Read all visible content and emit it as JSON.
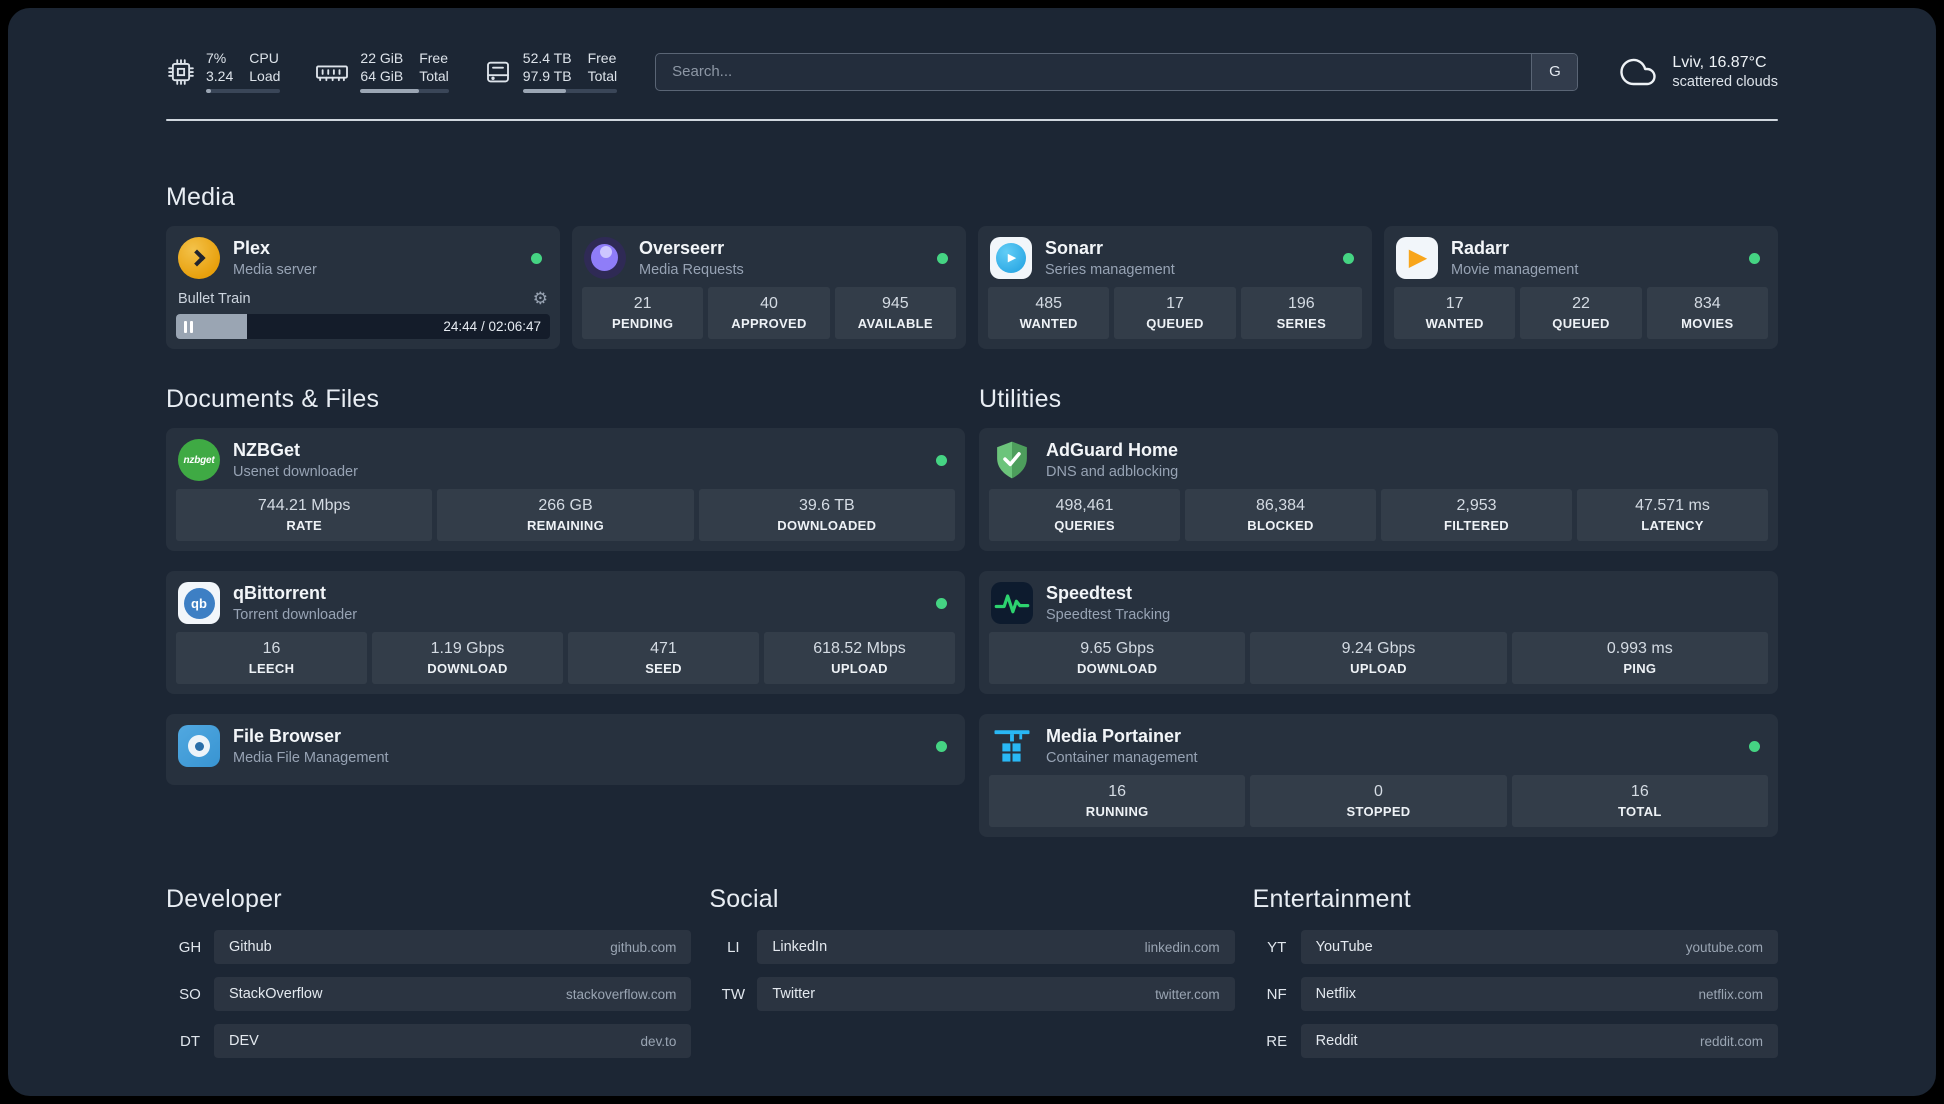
{
  "colors": {
    "status": "#45d483",
    "plex": "#e8a00c",
    "overseerr": "#8f7df8",
    "sonarr": "#1e9fe0",
    "radarr": "#f8a51b",
    "nzbget": "#3faa44",
    "qbittorrent": "#3d7fc4",
    "filebrowser": "#3894d2",
    "adguard": "#5cb46d",
    "speedtest": "#2dd36f",
    "portainer": "#29b8f5"
  },
  "topbar": {
    "cpu": {
      "usage": "7%",
      "load": "3.24",
      "label_top": "CPU",
      "label_bottom": "Load",
      "progress": 7
    },
    "memory": {
      "free": "22 GiB",
      "total": "64 GiB",
      "label_top": "Free",
      "label_bottom": "Total",
      "progress": 66
    },
    "disk": {
      "free": "52.4 TB",
      "total": "97.9 TB",
      "label_top": "Free",
      "label_bottom": "Total",
      "progress": 46
    },
    "search": {
      "placeholder": "Search...",
      "button_label": "G"
    },
    "weather": {
      "location": "Lviv, 16.87°C",
      "condition": "scattered clouds"
    }
  },
  "groups": [
    {
      "title": "Media",
      "cards": [
        {
          "id": "plex",
          "title": "Plex",
          "subtitle": "Media server",
          "online": true,
          "player": {
            "track": "Bullet Train",
            "time": "24:44 / 02:06:47",
            "progress": 19
          }
        },
        {
          "id": "overseerr",
          "title": "Overseerr",
          "subtitle": "Media Requests",
          "online": true,
          "stats": [
            {
              "value": "21",
              "label": "PENDING"
            },
            {
              "value": "40",
              "label": "APPROVED"
            },
            {
              "value": "945",
              "label": "AVAILABLE"
            }
          ]
        },
        {
          "id": "sonarr",
          "title": "Sonarr",
          "subtitle": "Series management",
          "online": true,
          "icon_text": "▶",
          "stats": [
            {
              "value": "485",
              "label": "WANTED"
            },
            {
              "value": "17",
              "label": "QUEUED"
            },
            {
              "value": "196",
              "label": "SERIES"
            }
          ]
        },
        {
          "id": "radarr",
          "title": "Radarr",
          "subtitle": "Movie management",
          "online": true,
          "icon_text": "▶",
          "stats": [
            {
              "value": "17",
              "label": "WANTED"
            },
            {
              "value": "22",
              "label": "QUEUED"
            },
            {
              "value": "834",
              "label": "MOVIES"
            }
          ]
        }
      ]
    },
    {
      "title": "Documents & Files",
      "cards": [
        {
          "id": "nzbget",
          "title": "NZBGet",
          "subtitle": "Usenet downloader",
          "online": true,
          "icon_text": "nzbget",
          "stats": [
            {
              "value": "744.21 Mbps",
              "label": "RATE"
            },
            {
              "value": "266 GB",
              "label": "REMAINING"
            },
            {
              "value": "39.6 TB",
              "label": "DOWNLOADED"
            }
          ]
        },
        {
          "id": "qbittorrent",
          "title": "qBittorrent",
          "subtitle": "Torrent downloader",
          "online": true,
          "icon_text": "qb",
          "stats": [
            {
              "value": "16",
              "label": "LEECH"
            },
            {
              "value": "1.19 Gbps",
              "label": "DOWNLOAD"
            },
            {
              "value": "471",
              "label": "SEED"
            },
            {
              "value": "618.52 Mbps",
              "label": "UPLOAD"
            }
          ]
        },
        {
          "id": "filebrowser",
          "title": "File Browser",
          "subtitle": "Media File Management",
          "online": true
        }
      ]
    },
    {
      "title": "Utilities",
      "cards": [
        {
          "id": "adguard",
          "title": "AdGuard Home",
          "subtitle": "DNS and adblocking",
          "online": false,
          "stats": [
            {
              "value": "498,461",
              "label": "QUERIES"
            },
            {
              "value": "86,384",
              "label": "BLOCKED"
            },
            {
              "value": "2,953",
              "label": "FILTERED"
            },
            {
              "value": "47.571 ms",
              "label": "LATENCY"
            }
          ]
        },
        {
          "id": "speedtest",
          "title": "Speedtest",
          "subtitle": "Speedtest Tracking",
          "online": false,
          "stats": [
            {
              "value": "9.65 Gbps",
              "label": "DOWNLOAD"
            },
            {
              "value": "9.24 Gbps",
              "label": "UPLOAD"
            },
            {
              "value": "0.993 ms",
              "label": "PING"
            }
          ]
        },
        {
          "id": "portainer",
          "title": "Media Portainer",
          "subtitle": "Container management",
          "online": true,
          "stats": [
            {
              "value": "16",
              "label": "RUNNING"
            },
            {
              "value": "0",
              "label": "STOPPED"
            },
            {
              "value": "16",
              "label": "TOTAL"
            }
          ]
        }
      ]
    }
  ],
  "bookmarks": [
    {
      "title": "Developer",
      "items": [
        {
          "abbr": "GH",
          "name": "Github",
          "url": "github.com"
        },
        {
          "abbr": "SO",
          "name": "StackOverflow",
          "url": "stackoverflow.com"
        },
        {
          "abbr": "DT",
          "name": "DEV",
          "url": "dev.to"
        }
      ]
    },
    {
      "title": "Social",
      "items": [
        {
          "abbr": "LI",
          "name": "LinkedIn",
          "url": "linkedin.com"
        },
        {
          "abbr": "TW",
          "name": "Twitter",
          "url": "twitter.com"
        }
      ]
    },
    {
      "title": "Entertainment",
      "items": [
        {
          "abbr": "YT",
          "name": "YouTube",
          "url": "youtube.com"
        },
        {
          "abbr": "NF",
          "name": "Netflix",
          "url": "netflix.com"
        },
        {
          "abbr": "RE",
          "name": "Reddit",
          "url": "reddit.com"
        }
      ]
    }
  ]
}
